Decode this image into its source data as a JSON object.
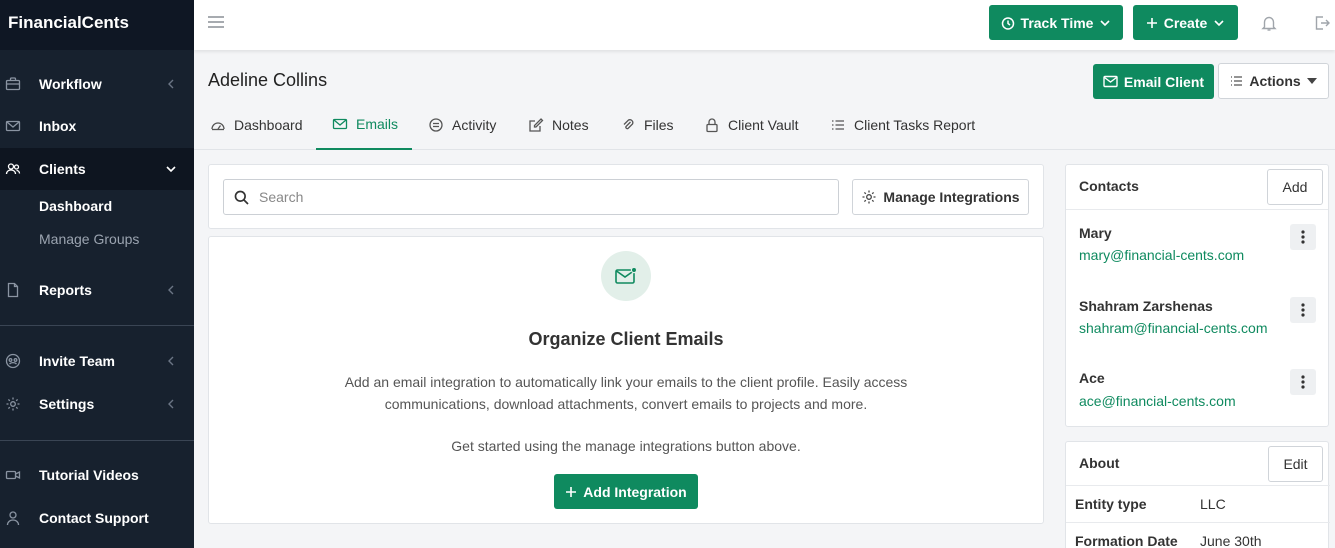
{
  "app": {
    "brand": "FinancialCents"
  },
  "sidebar": {
    "items": [
      {
        "label": "Workflow"
      },
      {
        "label": "Inbox"
      },
      {
        "label": "Clients"
      },
      {
        "label": "Reports"
      },
      {
        "label": "Invite Team"
      },
      {
        "label": "Settings"
      },
      {
        "label": "Tutorial Videos"
      },
      {
        "label": "Contact Support"
      }
    ],
    "sub_items": [
      {
        "label": "Dashboard"
      },
      {
        "label": "Manage Groups"
      }
    ]
  },
  "topbar": {
    "track_time_label": "Track Time",
    "create_label": "Create"
  },
  "header": {
    "client_name": "Adeline Collins",
    "email_client_label": "Email Client",
    "actions_label": "Actions"
  },
  "tabs": [
    {
      "label": "Dashboard",
      "icon": "dashboard-icon"
    },
    {
      "label": "Emails",
      "icon": "mail-icon"
    },
    {
      "label": "Activity",
      "icon": "activity-icon"
    },
    {
      "label": "Notes",
      "icon": "notes-icon"
    },
    {
      "label": "Files",
      "icon": "paperclip-icon"
    },
    {
      "label": "Client Vault",
      "icon": "lock-icon"
    },
    {
      "label": "Client Tasks Report",
      "icon": "list-icon"
    }
  ],
  "emails": {
    "search_placeholder": "Search",
    "manage_integrations_label": "Manage Integrations",
    "empty_title": "Organize Client Emails",
    "empty_description": "Add an email integration to automatically link your emails to the client profile. Easily access communications, download attachments, convert emails to projects and more.",
    "empty_hint": "Get started using the manage integrations button above.",
    "add_integration_label": "Add Integration"
  },
  "contacts": {
    "title": "Contacts",
    "add_label": "Add",
    "items": [
      {
        "name": "Mary",
        "email": "mary@financial-cents.com"
      },
      {
        "name": "Shahram Zarshenas",
        "email": "shahram@financial-cents.com"
      },
      {
        "name": "Ace",
        "email": "ace@financial-cents.com"
      }
    ]
  },
  "about": {
    "title": "About",
    "edit_label": "Edit",
    "rows": [
      {
        "key": "Entity type",
        "value": "LLC"
      },
      {
        "key": "Formation Date",
        "value": "June 30th"
      }
    ]
  },
  "colors": {
    "brand_green": "#0f8a5f",
    "sidebar_bg": "#17212e",
    "accent_light": "#e2efe9"
  }
}
